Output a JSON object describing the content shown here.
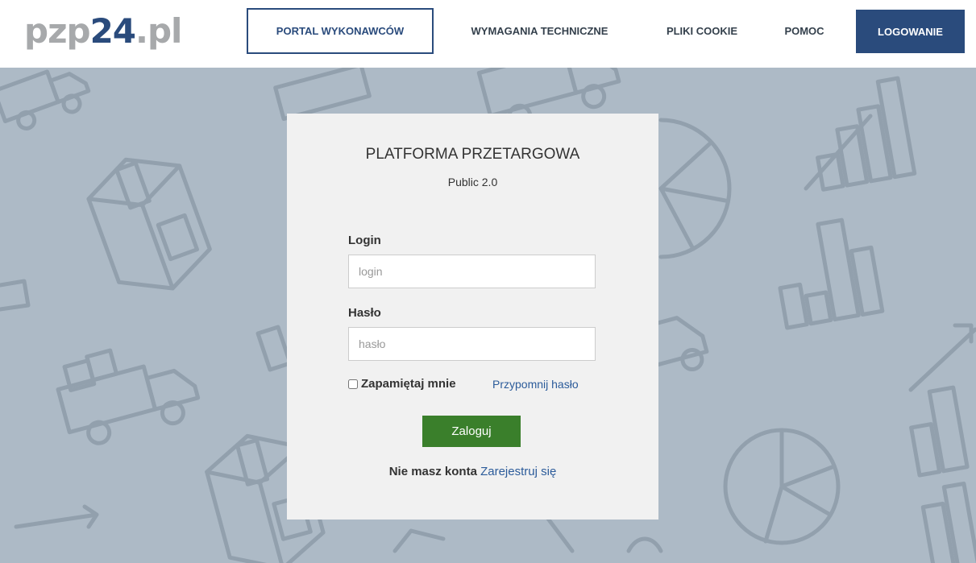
{
  "header": {
    "logo_prefix": "pzp",
    "logo_number": "24",
    "logo_suffix": ".pl",
    "nav": {
      "portal": "PORTAL WYKONAWCÓW",
      "wymagania": "WYMAGANIA TECHNICZNE",
      "cookie": "PLIKI COOKIE",
      "pomoc": "POMOC",
      "login": "LOGOWANIE"
    }
  },
  "card": {
    "title": "PLATFORMA PRZETARGOWA",
    "subtitle": "Public 2.0",
    "login_label": "Login",
    "login_placeholder": "login",
    "password_label": "Hasło",
    "password_placeholder": "hasło",
    "remember_label": "Zapamiętaj mnie",
    "forgot_link": "Przypomnij hasło",
    "submit_label": "Zaloguj",
    "register_question": "Nie masz konta",
    "register_link": "Zarejestruj się"
  },
  "colors": {
    "brand_blue": "#2a4b7c",
    "logo_gray": "#a7a9ab",
    "background_pattern": "#adbac6",
    "submit_green": "#3a7f2b",
    "link_blue": "#2b5b9a"
  }
}
